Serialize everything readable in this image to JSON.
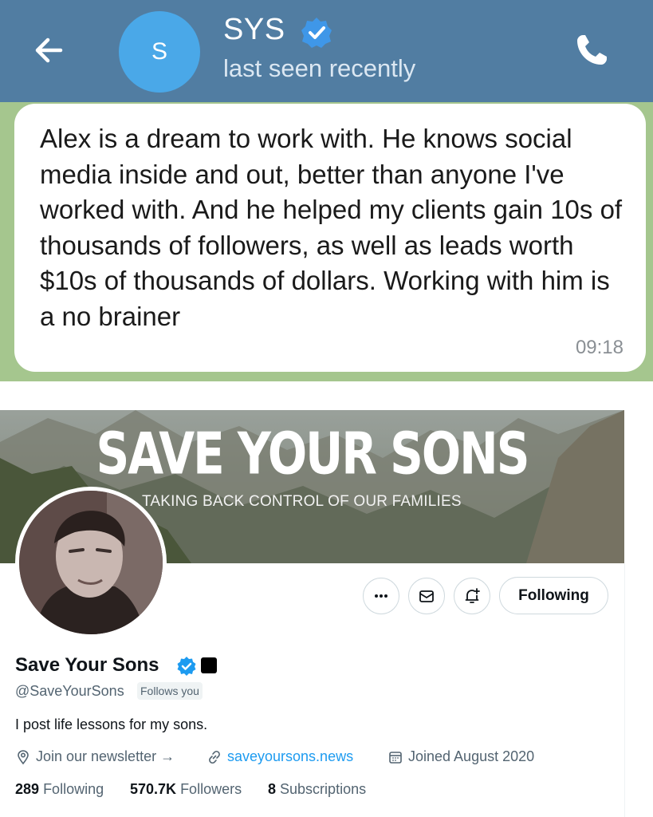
{
  "telegram": {
    "contact_name": "SYS",
    "avatar_initial": "S",
    "status": "last seen recently",
    "message": {
      "text": "Alex is a dream to work with. He knows social media inside and out, better than anyone I've worked with. And he helped my clients gain 10s of thousands of followers, as well as leads worth $10s of thousands of dollars. Working with him is a no brainer",
      "time": "09:18"
    },
    "colors": {
      "header": "#517da2",
      "avatar": "#4aa8e8",
      "chat_bg": "#a5c68e",
      "verified": "#3f97e8"
    },
    "icons": [
      "back-arrow-icon",
      "verified-badge-icon",
      "phone-icon"
    ]
  },
  "twitter_profile": {
    "banner": {
      "title": "SAVE YOUR SONS",
      "subtitle": "TAKING BACK CONTROL OF OUR FAMILIES"
    },
    "actions": {
      "more_icon": "more-horizontal-icon",
      "message_icon": "envelope-icon",
      "notify_icon": "bell-plus-icon",
      "follow_label": "Following"
    },
    "display_name": "Save Your Sons",
    "handle": "@SaveYourSons",
    "follows_you_badge": "Follows you",
    "bio": "I post life lessons for my sons.",
    "location": "Join our newsletter →",
    "website": "saveyoursons.news",
    "joined": "Joined August 2020",
    "stats": {
      "following_count": "289",
      "following_label": "Following",
      "followers_count": "570.7K",
      "followers_label": "Followers",
      "subscriptions_count": "8",
      "subscriptions_label": "Subscriptions"
    },
    "colors": {
      "verified": "#1d9bf0",
      "link": "#1d9bf0",
      "text_secondary": "#536471"
    }
  }
}
